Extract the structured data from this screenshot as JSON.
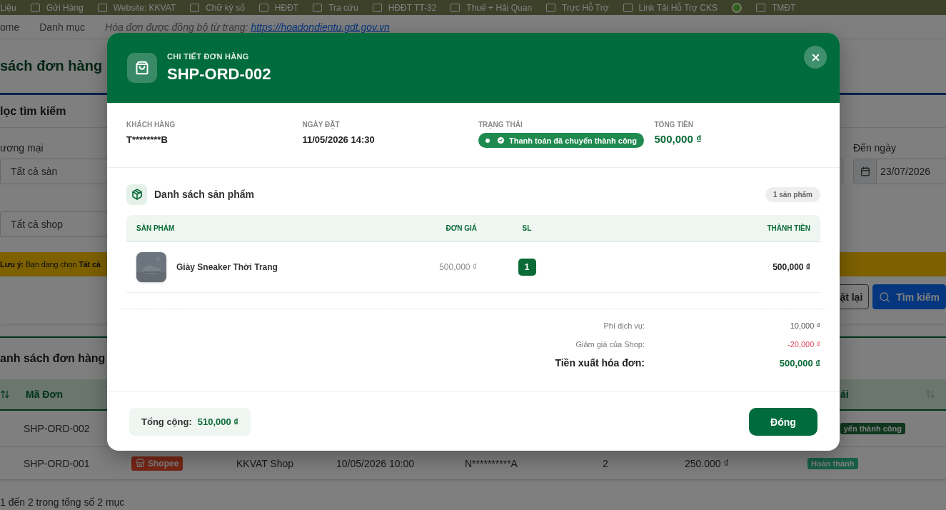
{
  "bookmarks": [
    {
      "label": "Liệu",
      "kind": "text"
    },
    {
      "label": "Gửi Hàng",
      "kind": "folder"
    },
    {
      "label": "Website: KKVAT",
      "kind": "folder"
    },
    {
      "label": "Chữ ký số",
      "kind": "folder"
    },
    {
      "label": "HĐĐT",
      "kind": "folder"
    },
    {
      "label": "Tra cứu",
      "kind": "folder"
    },
    {
      "label": "HĐĐT TT-32",
      "kind": "folder"
    },
    {
      "label": "Thuế + Hải Quan",
      "kind": "folder"
    },
    {
      "label": "Trực Hỗ Trợ",
      "kind": "folder"
    },
    {
      "label": "Link Tải Hỗ Trợ CKS",
      "kind": "folder"
    },
    {
      "kind": "site"
    },
    {
      "label": "TMĐT",
      "kind": "folder"
    }
  ],
  "breadcrumb": {
    "items": [
      "ome",
      "Danh mục"
    ],
    "note": "Hóa đơn được đồng bộ từ trang:",
    "link": "https://hoadondientu.gdt.gov.vn"
  },
  "page_title": "sách đơn hàng",
  "filter": {
    "title": "lọc tìm kiếm",
    "platform_label": "ương mại",
    "platform_value": "Tất cả sàn",
    "shop_value": "Tất cả shop",
    "to_label": "Đến ngày",
    "to_value": "23/07/2026",
    "note": "**Lưu ý:** Bạn đang chọn **Tất cả**",
    "buttons": [
      {
        "label": "ặt lại",
        "kind": "outline"
      },
      {
        "label": "Tìm kiếm",
        "kind": "primary"
      }
    ]
  },
  "orders": {
    "title": "anh sách đơn hàng",
    "columns": [
      "Mã Đơn",
      "ái"
    ],
    "rows": [
      {
        "code": "SHP-ORD-002",
        "status": {
          "label": "yển thành công",
          "kind": "paid"
        }
      },
      {
        "code": "SHP-ORD-001",
        "platform": "Shopee",
        "shop": "KKVAT Shop",
        "date": "10/05/2026 10:00",
        "customer": "N**********A",
        "qty": "2",
        "total": "250.000 ₫",
        "status": {
          "label": "Hoàn thành",
          "kind": "done"
        }
      }
    ],
    "footer": "1 đến 2 trong tổng số 2 mục"
  },
  "modal": {
    "subtitle": "CHI TIẾT ĐƠN HÀNG",
    "title": "SHP-ORD-002",
    "info": [
      {
        "label": "KHÁCH HÀNG",
        "value": "T********B",
        "kind": "text"
      },
      {
        "label": "NGÀY ĐẶT",
        "value": "11/05/2026 14:30",
        "kind": "text"
      },
      {
        "label": "TRẠNG THÁI",
        "value": "Thanh toán đã chuyển thành công",
        "kind": "status"
      },
      {
        "label": "TỔNG TIỀN",
        "value": "500,000 ₫",
        "kind": "amount"
      }
    ],
    "products_title": "Danh sách sản phẩm",
    "products_count": "1 sản phẩm",
    "columns": [
      "SẢN PHẨM",
      "ĐƠN GIÁ",
      "SL",
      "THÀNH TIỀN"
    ],
    "products": [
      {
        "name": "Giày Sneaker Thời Trang",
        "price": "500,000 ₫",
        "qty": "1",
        "total": "500,000 ₫"
      }
    ],
    "summary": [
      {
        "label": "Phí dịch vụ:",
        "value": "10,000 ₫",
        "kind": "normal"
      },
      {
        "label": "Giảm giá của Shop:",
        "value": "-20,000 ₫",
        "kind": "discount"
      },
      {
        "label": "Tiền xuất hóa đơn:",
        "value": "500,000 ₫",
        "kind": "total"
      }
    ],
    "grand_total_label": "Tổng cộng:",
    "grand_total": "510,000 ₫",
    "close_label": "Đóng"
  }
}
